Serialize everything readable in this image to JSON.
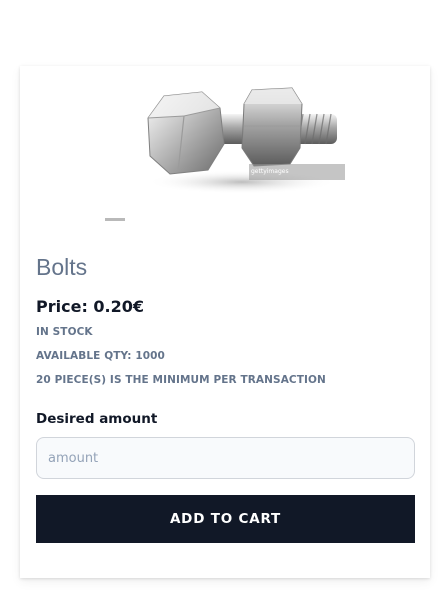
{
  "product": {
    "title": "Bolts",
    "price": "Price: 0.20€",
    "stock_status": "IN STOCK",
    "available_qty": "AVAILABLE QTY: 1000",
    "minimum_note": "20 PIECE(S) IS THE MINIMUM PER TRANSACTION",
    "image": {
      "icon": "bolt-and-nut-image",
      "watermark": "gettyimages"
    }
  },
  "form": {
    "amount_label": "Desired amount",
    "amount_placeholder": "amount",
    "amount_value": "",
    "add_to_cart_label": "ADD TO CART"
  },
  "colors": {
    "title": "#64748b",
    "button_bg": "#111827",
    "muted": "#64748b"
  }
}
